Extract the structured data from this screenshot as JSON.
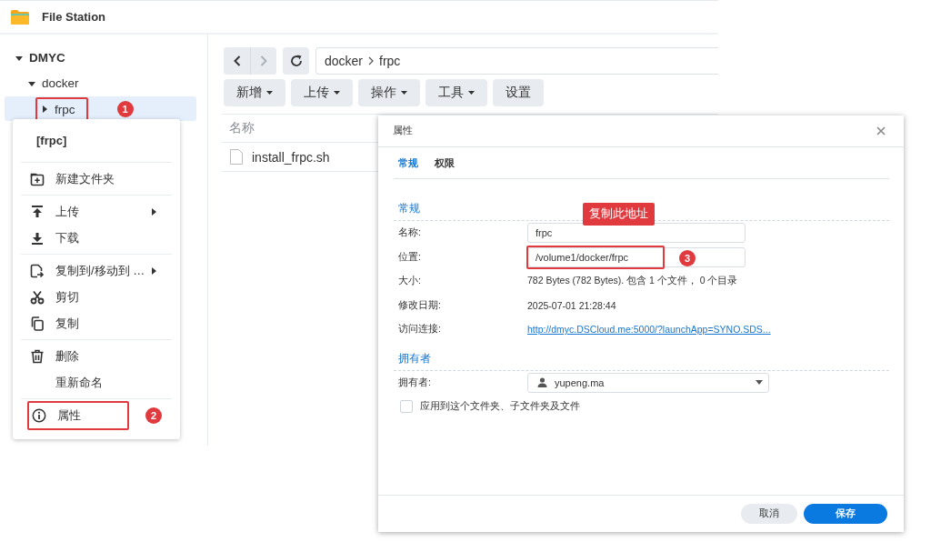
{
  "window": {
    "title": "File Station"
  },
  "sidebar": {
    "tree": [
      {
        "label": "DMYC",
        "expanded": true,
        "selected": false,
        "children": [
          {
            "label": "docker",
            "expanded": true,
            "selected": false,
            "children": [
              {
                "label": "frpc",
                "expanded": false,
                "selected": true,
                "annotation": {
                  "badge": "1"
                }
              }
            ]
          }
        ]
      }
    ]
  },
  "context_menu": {
    "title": "[frpc]",
    "groups": [
      [
        {
          "label": "新建文件夹",
          "submenu": false
        }
      ],
      [
        {
          "label": "上传",
          "submenu": true
        },
        {
          "label": "下载",
          "submenu": false
        }
      ],
      [
        {
          "label": "复制到/移动到 …",
          "submenu": true
        },
        {
          "label": "剪切",
          "submenu": false
        },
        {
          "label": "复制",
          "submenu": false
        }
      ],
      [
        {
          "label": "删除",
          "submenu": false
        },
        {
          "label": "重新命名",
          "submenu": false
        }
      ],
      [
        {
          "label": "属性",
          "submenu": false,
          "annotation": {
            "badge": "2"
          }
        }
      ]
    ]
  },
  "toolbar": {
    "back": {
      "disabled": false
    },
    "forward": {
      "disabled": true
    },
    "path": [
      "docker",
      "frpc"
    ],
    "buttons": [
      {
        "label": "新增",
        "dropdown": true
      },
      {
        "label": "上传",
        "dropdown": true
      },
      {
        "label": "操作",
        "dropdown": true
      },
      {
        "label": "工具",
        "dropdown": true
      },
      {
        "label": "设置",
        "dropdown": false
      }
    ]
  },
  "file_list": {
    "columns": [
      "名称"
    ],
    "rows": [
      {
        "name": "install_frpc.sh"
      }
    ]
  },
  "dialog": {
    "title": "属性",
    "tabs": [
      {
        "label": "常规",
        "selected": true
      },
      {
        "label": "权限",
        "selected": false
      }
    ],
    "sections": [
      {
        "heading": "常规",
        "fields": [
          {
            "kind": "input",
            "label": "名称:",
            "value": "frpc"
          },
          {
            "kind": "input",
            "label": "位置:",
            "value": "/volume1/docker/frpc",
            "annotation": {
              "badge": "3",
              "callout": "复制此地址"
            }
          },
          {
            "kind": "text",
            "label": "大小:",
            "value": "782 Bytes (782 Bytes). 包含 1 个文件， 0 个目录"
          },
          {
            "kind": "text",
            "label": "修改日期:",
            "value": "2025-07-01 21:28:44"
          },
          {
            "kind": "link",
            "label": "访问连接:",
            "value": "http://dmyc.DSCloud.me:5000/?launchApp=SYNO.SDS..."
          }
        ]
      },
      {
        "heading": "拥有者",
        "fields": [
          {
            "kind": "select",
            "label": "拥有者:",
            "value": "yupeng.ma"
          },
          {
            "kind": "checkbox",
            "label": "应用到这个文件夹、子文件夹及文件",
            "checked": false
          }
        ]
      }
    ],
    "buttons": [
      {
        "label": "取消",
        "kind": "secondary"
      },
      {
        "label": "保存",
        "kind": "primary"
      }
    ]
  }
}
